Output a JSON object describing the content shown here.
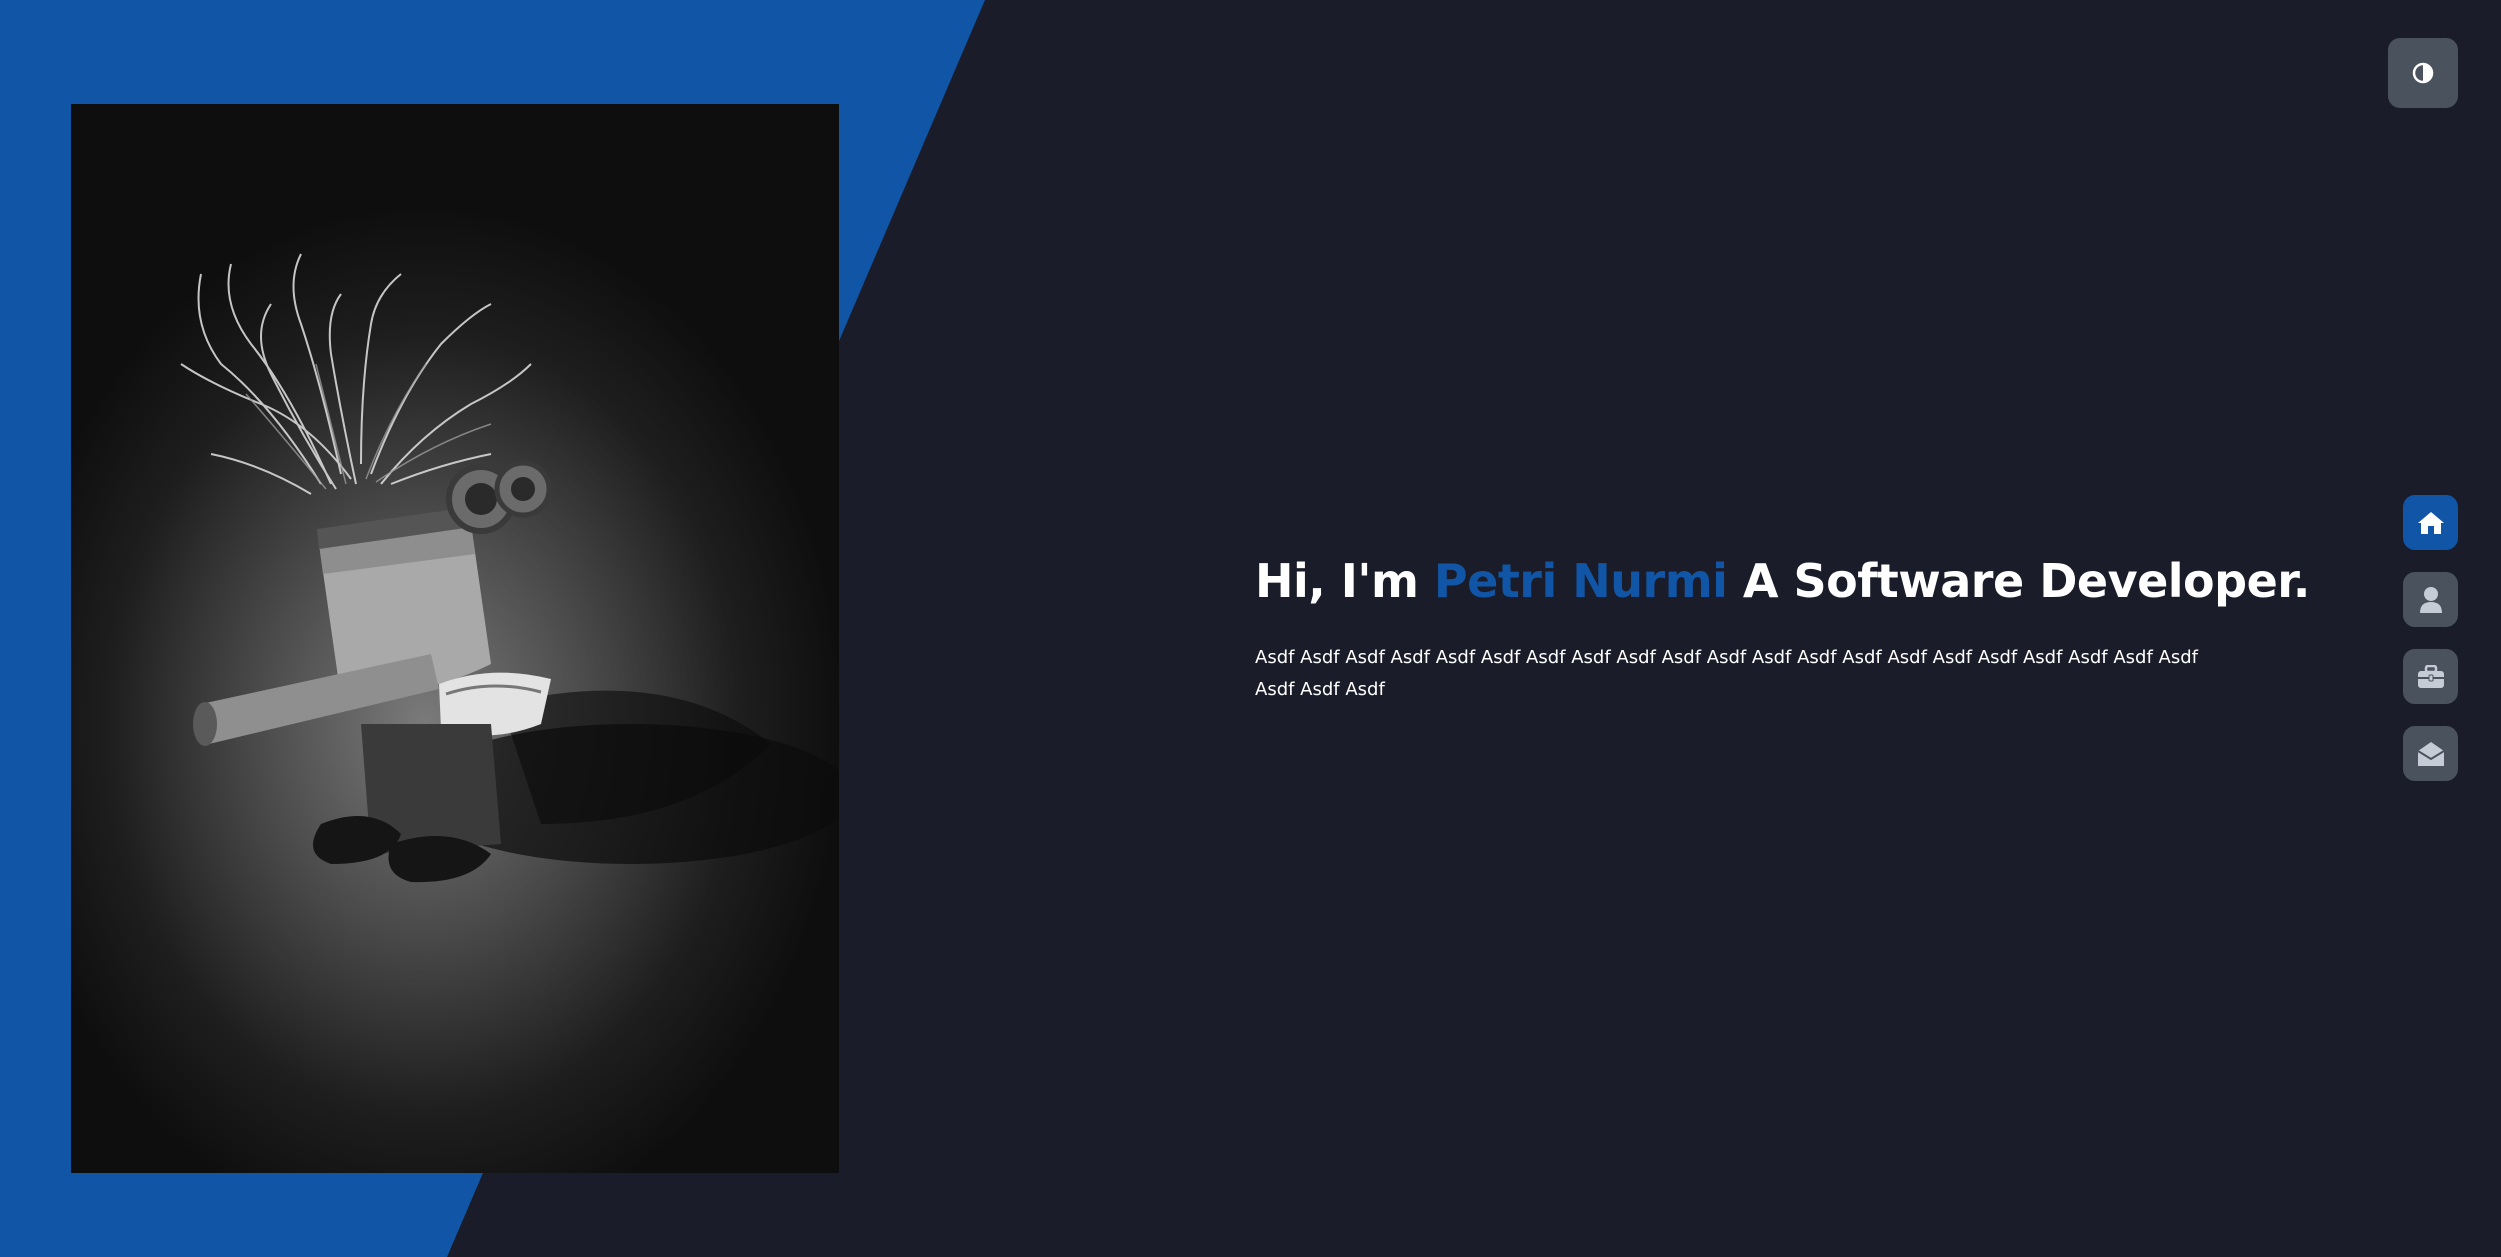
{
  "header": {
    "theme_toggle_icon": "contrast-icon"
  },
  "hero": {
    "greeting": "Hi, I'm ",
    "name": "Petri Nurmi",
    "tagline": " A Software Developer.",
    "description": "Asdf Asdf Asdf Asdf Asdf Asdf Asdf Asdf Asdf Asdf Asdf Asdf Asdf Asdf Asdf Asdf Asdf Asdf Asdf Asdf Asdf Asdf Asdf Asdf"
  },
  "nav": {
    "items": [
      {
        "icon": "home-icon",
        "active": true
      },
      {
        "icon": "user-icon",
        "active": false
      },
      {
        "icon": "briefcase-icon",
        "active": false
      },
      {
        "icon": "envelope-open-icon",
        "active": false
      }
    ]
  },
  "colors": {
    "background": "#1a1c29",
    "accent": "#1156a6",
    "button": "#4a525e",
    "text": "#ffffff"
  }
}
